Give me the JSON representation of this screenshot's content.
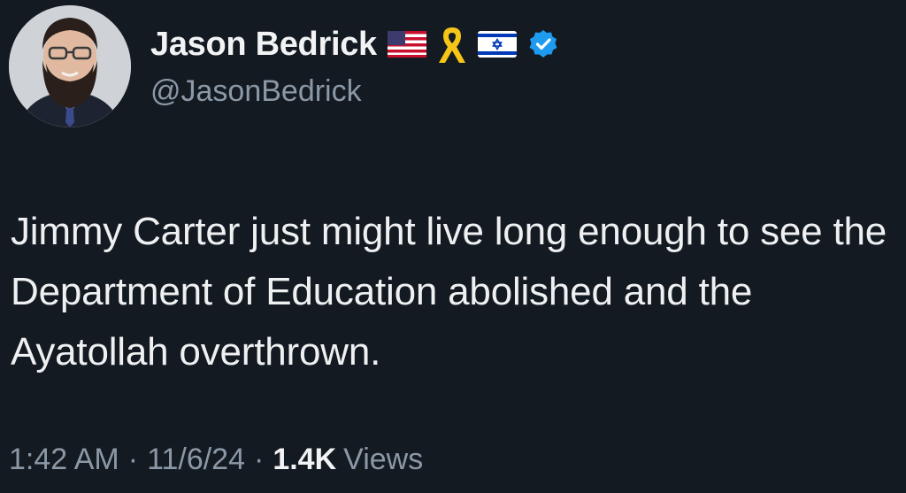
{
  "author": {
    "display_name": "Jason Bedrick",
    "handle": "@JasonBedrick",
    "name_badges": [
      "us-flag-icon",
      "yellow-ribbon-icon",
      "israel-flag-icon",
      "verified-badge-icon"
    ],
    "verified_color": "#1d9bf0"
  },
  "tweet": {
    "text": "Jimmy Carter just might live long enough to see the Department of Education abolished and the Ayatollah overthrown."
  },
  "meta": {
    "time": "1:42 AM",
    "separator": "·",
    "date": "11/6/24",
    "views_count": "1.4K",
    "views_label": "Views"
  },
  "colors": {
    "background": "#141a22",
    "primary_text": "#e7e9ea",
    "secondary_text": "#8b98a5"
  }
}
